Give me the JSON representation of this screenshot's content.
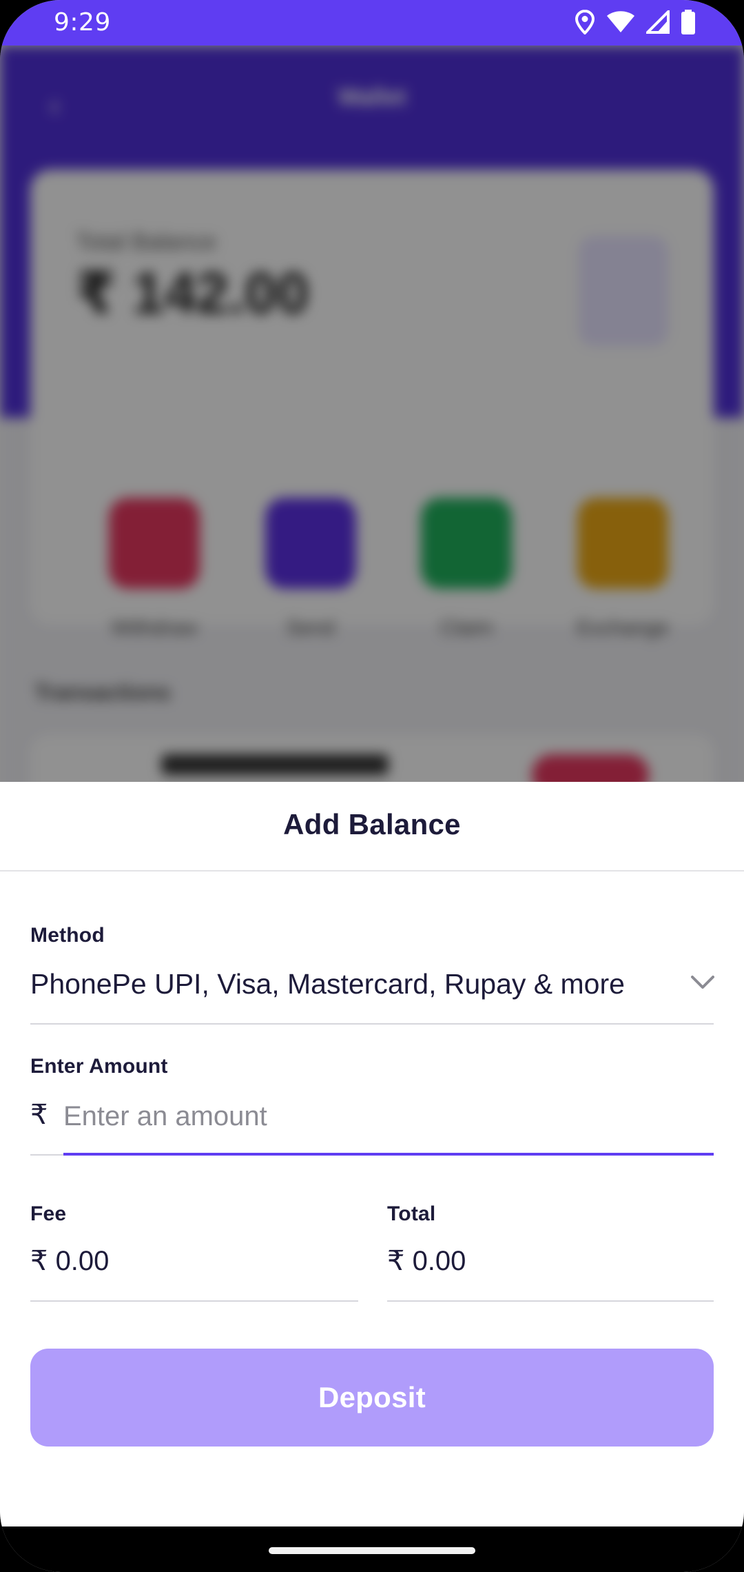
{
  "status_bar": {
    "time": "9:29",
    "icons": [
      "location-icon",
      "wifi-icon",
      "signal-icon",
      "battery-icon"
    ]
  },
  "background_screen": {
    "title": "Wallet",
    "balance_label": "Total Balance",
    "balance_amount": "₹ 142.00",
    "actions": [
      {
        "label": "Withdraw",
        "color": "#e2365e"
      },
      {
        "label": "Send",
        "color": "#5a2fe0"
      },
      {
        "label": "Claim",
        "color": "#1fae5b"
      },
      {
        "label": "Exchange",
        "color": "#e8a615"
      }
    ],
    "section_title": "Transactions"
  },
  "sheet": {
    "title": "Add Balance",
    "method": {
      "label": "Method",
      "value": "PhonePe UPI, Visa, Mastercard, Rupay & more"
    },
    "amount": {
      "label": "Enter Amount",
      "currency": "₹",
      "value": "",
      "placeholder": "Enter an amount"
    },
    "fee": {
      "label": "Fee",
      "value": "₹ 0.00"
    },
    "total": {
      "label": "Total",
      "value": "₹ 0.00"
    },
    "deposit_label": "Deposit"
  },
  "colors": {
    "accent": "#5f3df2",
    "button_disabled": "#b09cfb",
    "text_primary": "#1d1b3a",
    "placeholder": "#8b8b93"
  }
}
